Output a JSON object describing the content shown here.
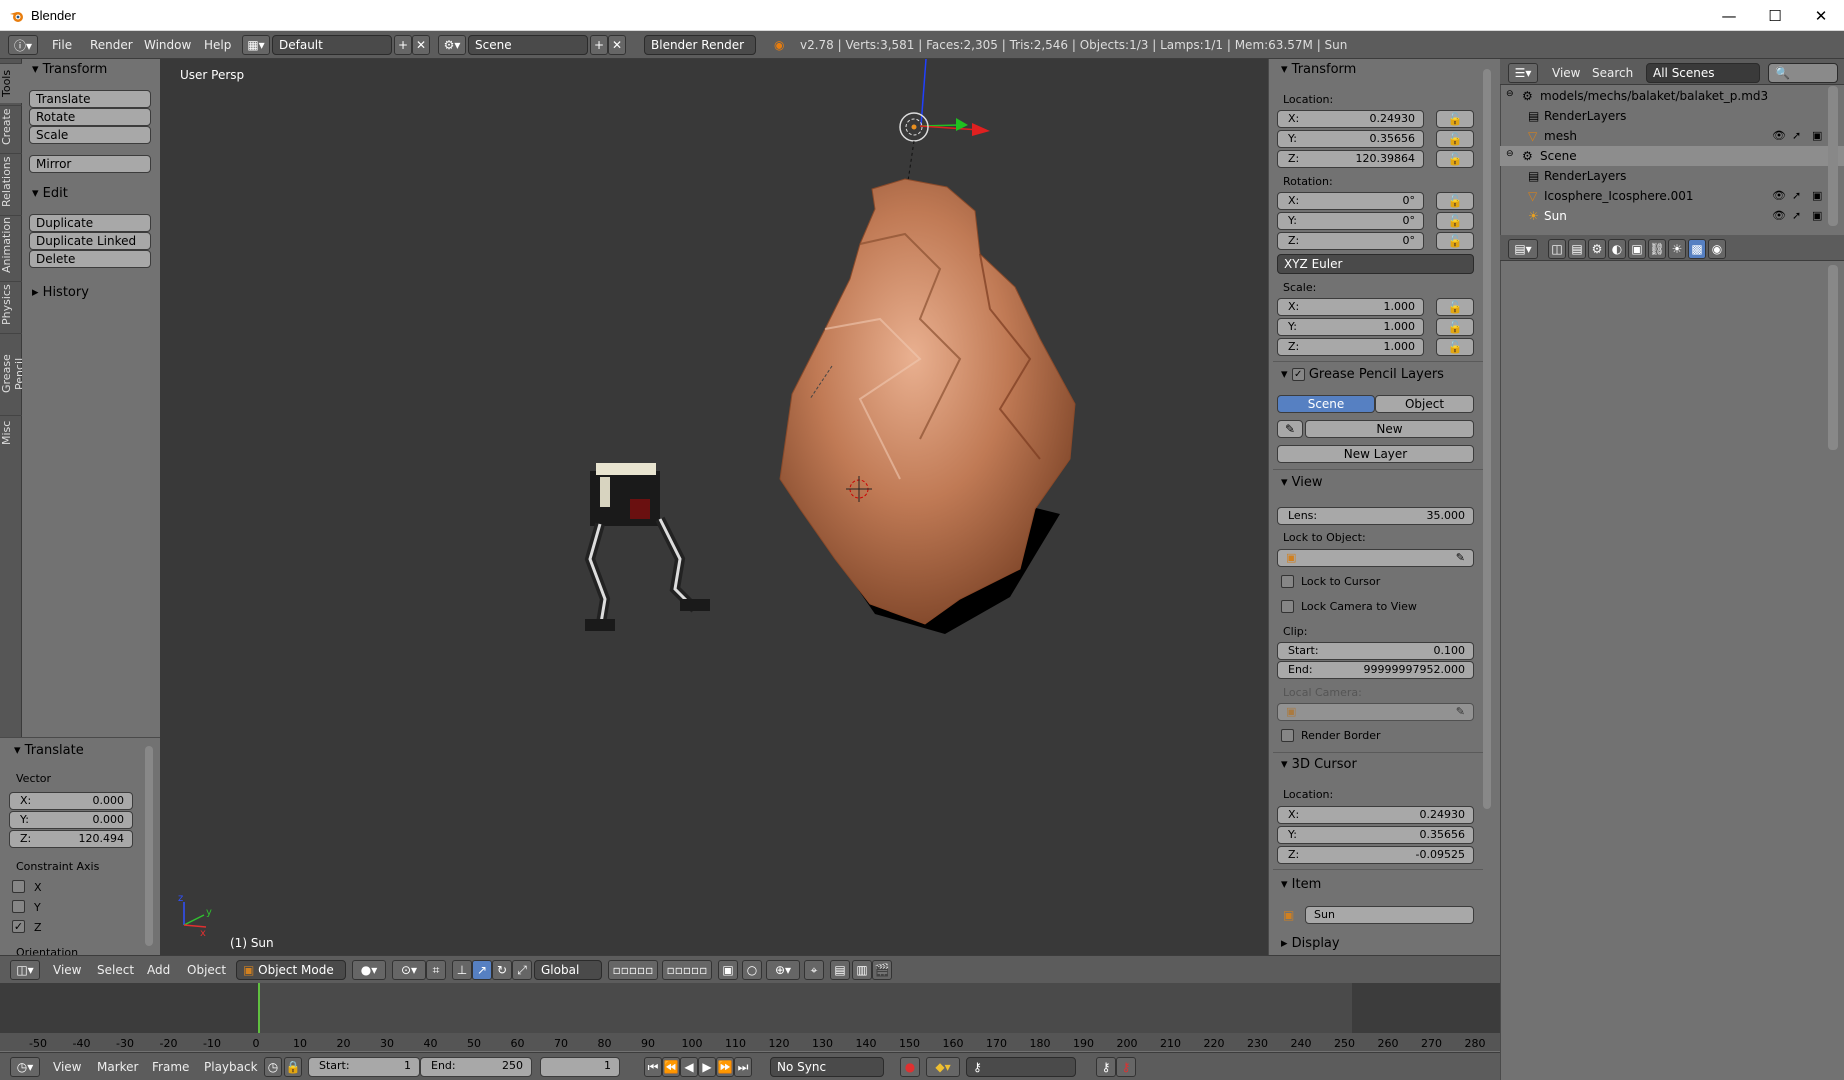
{
  "window": {
    "title": "Blender",
    "minimize": "—",
    "maximize": "☐",
    "close": "✕"
  },
  "info_header": {
    "menu": [
      "File",
      "Render",
      "Window",
      "Help"
    ],
    "layout": "Default",
    "scene": "Scene",
    "engine": "Blender Render",
    "stats": "v2.78 | Verts:3,581 | Faces:2,305 | Tris:2,546 | Objects:1/3 | Lamps:1/1 | Mem:63.57M | Sun"
  },
  "tool_tabs": [
    "Tools",
    "Create",
    "Relations",
    "Animation",
    "Physics",
    "Grease Pencil",
    "Misc"
  ],
  "toolshelf": {
    "transform_title": "Transform",
    "transform_buttons": [
      "Translate",
      "Rotate",
      "Scale"
    ],
    "mirror": "Mirror",
    "edit_title": "Edit",
    "edit_buttons": [
      "Duplicate",
      "Duplicate Linked",
      "Delete"
    ],
    "history": "History"
  },
  "operator": {
    "title": "Translate",
    "vector_label": "Vector",
    "x": "0.000",
    "y": "0.000",
    "z": "120.494",
    "xl": "X:",
    "yl": "Y:",
    "zl": "Z:",
    "constraint": "Constraint Axis",
    "axes": [
      "X",
      "Y",
      "Z"
    ],
    "axes_checked": [
      false,
      false,
      true
    ],
    "orientation": "Orientation"
  },
  "viewport": {
    "view_name": "User Persp",
    "object_label": "(1) Sun"
  },
  "npanel": {
    "transform": "Transform",
    "location": "Location:",
    "loc": {
      "x": "0.24930",
      "y": "0.35656",
      "z": "120.39864"
    },
    "rotation": "Rotation:",
    "rot": {
      "x": "0°",
      "y": "0°",
      "z": "0°"
    },
    "euler": "XYZ Euler",
    "scale": "Scale:",
    "scl": {
      "x": "1.000",
      "y": "1.000",
      "z": "1.000"
    },
    "gp": "Grease Pencil Layers",
    "gp_scene": "Scene",
    "gp_object": "Object",
    "gp_new": "New",
    "gp_new_layer": "New Layer",
    "view": "View",
    "lens_label": "Lens:",
    "lens": "35.000",
    "lock_object": "Lock to Object:",
    "lock_cursor": "Lock to Cursor",
    "lock_camera": "Lock Camera to View",
    "clip": "Clip:",
    "clip_start_label": "Start:",
    "clip_start": "0.100",
    "clip_end_label": "End:",
    "clip_end": "99999997952.000",
    "local_camera": "Local Camera:",
    "render_border": "Render Border",
    "cursor": "3D Cursor",
    "cursor_location": "Location:",
    "cur": {
      "x": "0.24930",
      "y": "0.35656",
      "z": "-0.09525"
    },
    "item": "Item",
    "item_name": "Sun",
    "display": "Display",
    "xl": "X:",
    "yl": "Y:",
    "zl": "Z:"
  },
  "outliner": {
    "view": "View",
    "search": "Search",
    "filter": "All Scenes",
    "rows": [
      "models/mechs/balaket/balaket_p.md3",
      "RenderLayers",
      "mesh",
      "Scene",
      "RenderLayers",
      "Icosphere_Icosphere.001",
      "Sun"
    ]
  },
  "view3d_header": {
    "menu": [
      "View",
      "Select",
      "Add",
      "Object"
    ],
    "mode": "Object Mode",
    "orientation": "Global"
  },
  "timeline": {
    "ticks": [
      "-50",
      "-40",
      "-30",
      "-20",
      "-10",
      "0",
      "10",
      "20",
      "30",
      "40",
      "50",
      "60",
      "70",
      "80",
      "90",
      "100",
      "110",
      "120",
      "130",
      "140",
      "150",
      "160",
      "170",
      "180",
      "190",
      "200",
      "210",
      "220",
      "230",
      "240",
      "250",
      "260",
      "270",
      "280"
    ],
    "menu": [
      "View",
      "Marker",
      "Frame",
      "Playback"
    ],
    "start_label": "Start:",
    "start": "1",
    "end_label": "End:",
    "end": "250",
    "current": "1",
    "sync": "No Sync"
  },
  "colors": {
    "viewport_bg": "#393939",
    "panel_bg": "#727272",
    "header_bg": "#5c5c5c",
    "accent_blue": "#5680c2",
    "playhead": "#60c040"
  }
}
